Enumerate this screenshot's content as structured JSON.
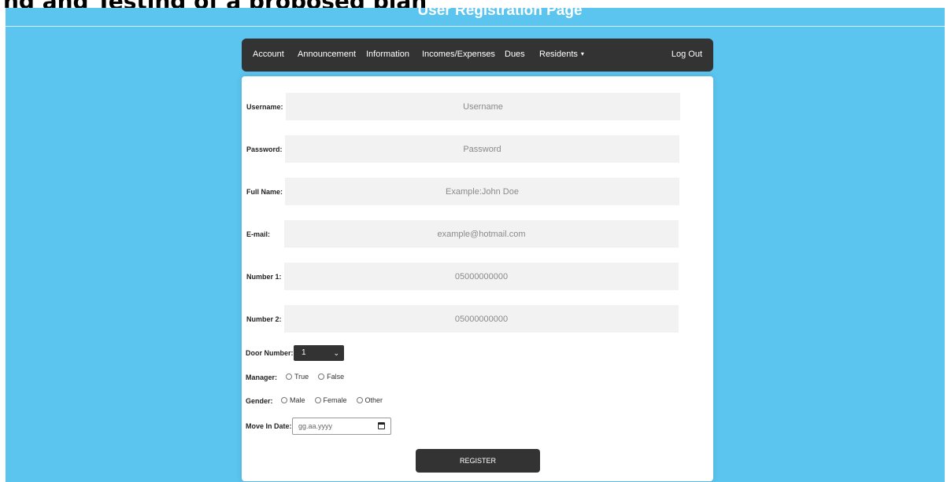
{
  "page": {
    "heading": "User Registration Page",
    "top_strip": "ng and Testing of a proposed plan"
  },
  "colors": {
    "background": "#5bc4ef",
    "nav": "#333333",
    "input": "#f2f2f2"
  },
  "nav": {
    "items": [
      "Account",
      "Announcement",
      "Information",
      "Incomes/Expenses",
      "Dues",
      "Residents"
    ],
    "dropdown_caret": "▾",
    "logout": "Log Out"
  },
  "form": {
    "username": {
      "label": "Username:",
      "placeholder": "Username"
    },
    "password": {
      "label": "Password:",
      "placeholder": "Password"
    },
    "fullname": {
      "label": "Full Name:",
      "placeholder": "Example:John Doe"
    },
    "email": {
      "label": "E-mail:",
      "placeholder": "example@hotmail.com"
    },
    "number1": {
      "label": "Number 1:",
      "placeholder": "05000000000"
    },
    "number2": {
      "label": "Number 2:",
      "placeholder": "05000000000"
    },
    "door": {
      "label": "Door Number:",
      "selected": "1"
    },
    "manager": {
      "label": "Manager:",
      "options": [
        "True",
        "False"
      ]
    },
    "gender": {
      "label": "Gender:",
      "options": [
        "Male",
        "Female",
        "Other"
      ]
    },
    "move_in": {
      "label": "Move In Date:",
      "placeholder": "gg.aa.yyyy"
    },
    "submit": "REGISTER"
  }
}
